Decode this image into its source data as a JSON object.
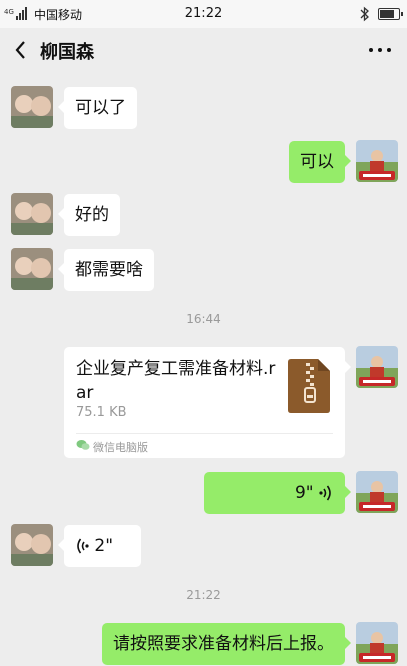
{
  "status_bar": {
    "network": "4G",
    "carrier": "中国移动",
    "time": "21:22"
  },
  "header": {
    "title": "柳国森"
  },
  "messages": [
    {
      "side": "in",
      "text": "可以了"
    },
    {
      "side": "out",
      "text": "可以"
    },
    {
      "side": "in",
      "text": "好的"
    },
    {
      "side": "in",
      "text": "都需要啥"
    },
    {
      "timestamp": "16:44"
    },
    {
      "side": "out",
      "type": "file",
      "file_name": "企业复产复工需准备材料.rar",
      "file_size": "75.1 KB",
      "source": "微信电脑版",
      "icon": "zip-file-icon"
    },
    {
      "side": "out",
      "type": "voice",
      "duration": "9\""
    },
    {
      "side": "in",
      "type": "voice",
      "duration": "2\""
    },
    {
      "timestamp": "21:22"
    },
    {
      "side": "out",
      "text": "请按照要求准备材料后上报。"
    }
  ],
  "colors": {
    "outgoing_bubble": "#95ec69",
    "incoming_bubble": "#ffffff",
    "background": "#ededed",
    "file_icon": "#8b5a2b"
  }
}
